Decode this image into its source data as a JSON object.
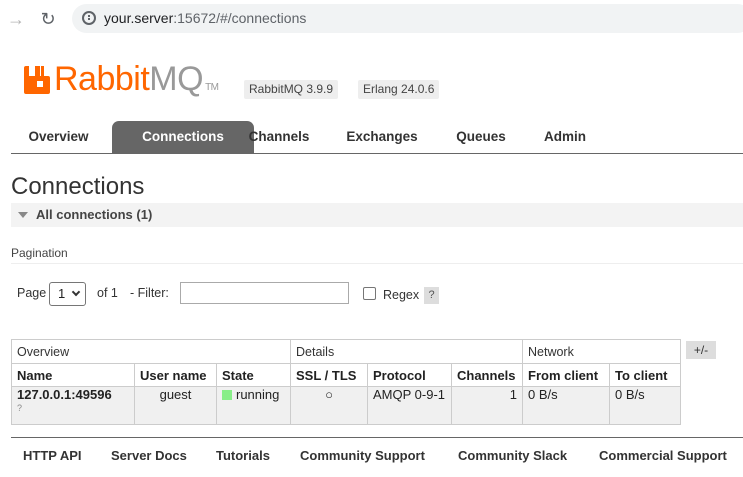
{
  "browser": {
    "url_host": "your.server",
    "url_rest": ":15672/#/connections"
  },
  "header": {
    "logo_rabbit": "Rabbit",
    "logo_mq": "MQ",
    "logo_tm": "TM",
    "rabbitmq_version": "RabbitMQ 3.9.9",
    "erlang_version": "Erlang 24.0.6",
    "brand_color": "#ff6600"
  },
  "tabs": [
    {
      "label": "Overview",
      "active": false
    },
    {
      "label": "Connections",
      "active": true
    },
    {
      "label": "Channels",
      "active": false
    },
    {
      "label": "Exchanges",
      "active": false
    },
    {
      "label": "Queues",
      "active": false
    },
    {
      "label": "Admin",
      "active": false
    }
  ],
  "page": {
    "title": "Connections",
    "section_title": "All connections (1)",
    "pagination_label": "Pagination",
    "page_label": "Page",
    "page_value": "1",
    "of_label": "of 1",
    "filter_label": "- Filter:",
    "filter_value": "",
    "regex_label": "Regex",
    "regex_checked": false,
    "help_label": "?",
    "toggle_columns_label": "+/-"
  },
  "table": {
    "groups": [
      "Overview",
      "Details",
      "Network"
    ],
    "columns": [
      "Name",
      "User name",
      "State",
      "SSL / TLS",
      "Protocol",
      "Channels",
      "From client",
      "To client"
    ],
    "rows": [
      {
        "name": "127.0.0.1:49596",
        "name_sub": "?",
        "user": "guest",
        "state": "running",
        "ssl": "○",
        "protocol": "AMQP 0-9-1",
        "channels": "1",
        "from_client": "0 B/s",
        "to_client": "0 B/s"
      }
    ]
  },
  "footer": {
    "links": [
      "HTTP API",
      "Server Docs",
      "Tutorials",
      "Community Support",
      "Community Slack",
      "Commercial Support"
    ]
  }
}
